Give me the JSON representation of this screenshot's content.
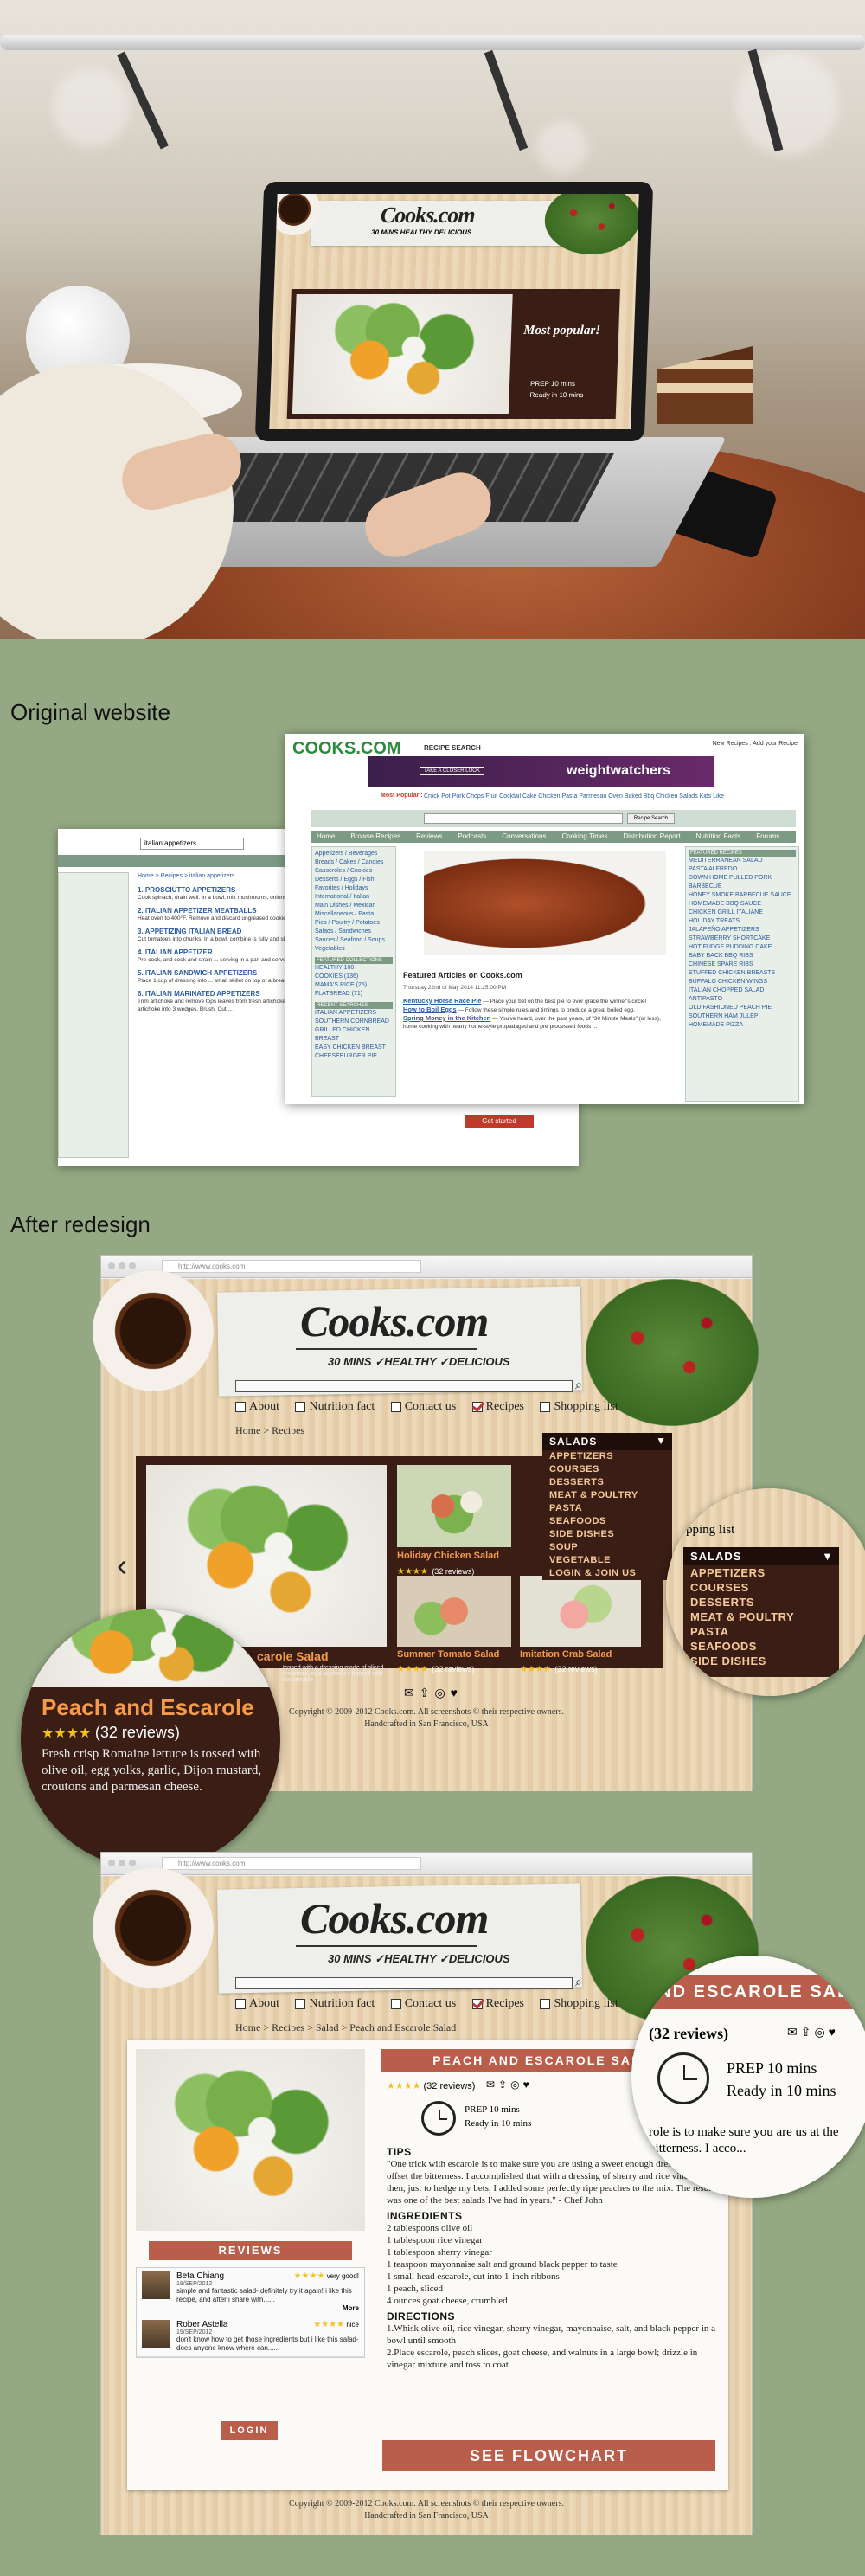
{
  "labels": {
    "original": "Original website",
    "after": "After redesign"
  },
  "laptop": {
    "logo": "Cooks.com",
    "tags": "30 MINS  HEALTHY  DELICIOUS",
    "popular": "Most popular!",
    "prep": "PREP 10 mins",
    "ready": "Ready in 10 mins"
  },
  "orig": {
    "logo": "COOKS.COM",
    "logo_sub": "RECIPE SEARCH",
    "top_links": "New Recipes : Add your Recipe",
    "ad_text": "weightwatchers",
    "ad_btn": "TAKE A CLOSER LOOK",
    "popular_label": "Most Popular :",
    "popular_links": "Crock Pot Pork Chops  Fruit Cocktail Cake  Chicken Pasta Parmesan  Oven Baked Bbq Chicken  Salads Kids Like",
    "search_btn": "Recipe Search",
    "nav": [
      "Home",
      "Browse Recipes",
      "Reviews",
      "Podcasts",
      "Conversations",
      "Cooking Times",
      "Distribution Report",
      "Nutrition Facts",
      "Forums"
    ],
    "categories": [
      "Appetizers / Beverages",
      "Breads / Cakes / Candies",
      "Casseroles / Cookies",
      "Desserts / Eggs / Fish",
      "Favorites / Holidays",
      "International / Italian",
      "Main Dishes / Mexican",
      "Miscellaneous / Pasta",
      "Pies / Poultry / Potatoes",
      "Salads / Sandwiches",
      "Sauces / Seafood / Soups",
      "Vegetables"
    ],
    "featured_collections": "FEATURED COLLECTIONS",
    "collections": [
      "HEALTHY 100",
      "COOKIES (136)",
      "MAMA'S RICE (25)",
      "FLATBREAD (71)"
    ],
    "recent_searches": "RECENT SEARCHES",
    "recent": [
      "ITALIAN APPETIZERS",
      "SOUTHERN CORNBREAD",
      "GRILLED CHICKEN BREAST",
      "EASY CHICKEN BREAST",
      "CHEESEBURGER PIE"
    ],
    "featured_articles": "Featured Articles on Cooks.com",
    "date": "Thursday 22nd of May 2014 11:25:00 PM",
    "articles": [
      {
        "title": "Kentucky Horse Race Pie",
        "text": " — Place your bet on the best pie to ever grace the winner's circle!"
      },
      {
        "title": "How to Boil Eggs",
        "text": " — Follow these simple rules and timings to produce a great boiled egg."
      },
      {
        "title": "Spring Money in the Kitchen",
        "text": " — You've heard, over the past years, of \"30 Minute Meals\" (or less), home cooking with hearty home-style propadaged and pre processed foods ..."
      }
    ],
    "featured_recipes": "FEATURED RECIPES",
    "recipes": [
      "MEDITERRANEAN SALAD",
      "PASTA ALFREDO",
      "DOWN HOME PULLED PORK BARBECUE",
      "HONEY SMOKE BARBECUE SAUCE",
      "HOMEMADE BBQ SAUCE",
      "CHICKEN GRILL ITALIANE",
      "HOLIDAY TREATS",
      "JALAPEÑO APPETIZERS",
      "STRAWBERRY SHORTCAKE",
      "HOT FUDGE PUDDING CAKE",
      "BABY BACK BBQ RIBS",
      "CHINESE SPARE RIBS",
      "STUFFED CHICKEN BREASTS",
      "BUFFALO CHICKEN WINGS",
      "ITALIAN CHOPPED SALAD ANTIPASTO",
      "OLD FASHIONED PEACH PIE",
      "SOUTHERN HAM JULEP",
      "HOMEMADE PIZZA"
    ],
    "back_search": "italian appetizers",
    "back_crumb": "Home > Recipes > italian appetizers",
    "back_results": [
      {
        "title": "1. PROSCIUTTO APPETIZERS",
        "text": "Cook spinach, drain well. In a bowl, mix mushrooms, onions, crisp peppers, and mix. Turn ..."
      },
      {
        "title": "2. ITALIAN APPETIZER MEATBALLS",
        "text": "Heat oven to 400°F. Remove and discard ungreased cookie sheet; place ..."
      },
      {
        "title": "3. APPETIZING ITALIAN BREAD",
        "text": "Cut tomatoes into chunks. In a bowl, combine is fully and shaded but a hint in a toasted pecorino ..."
      },
      {
        "title": "4. ITALIAN APPETIZER",
        "text": "Pre-cook, and cook and strain ... serving in a pan and serve ..."
      },
      {
        "title": "5. ITALIAN SANDWICH APPETIZERS",
        "text": "Place 1 cup of dressing into ... small skillet on top of a bread ..."
      },
      {
        "title": "6. ITALIAN MARINATED APPETIZERS",
        "text": "Trim artichoke and remove tops leaves from fresh artichokes. Cut 1 inch off tops, snip off sharp leaf tips. Cut each artichoke into 3 wedges. Brush. Cut ..."
      }
    ],
    "get_started": "Get started"
  },
  "r1": {
    "url": "http://www.cooks.com",
    "logo": "Cooks.com",
    "tags": [
      "30 MINS",
      "HEALTHY",
      "DELICIOUS"
    ],
    "nav": [
      "About",
      "Nutrition fact",
      "Contact us",
      "Recipes",
      "Shopping list"
    ],
    "crumb": "Home > Recipes",
    "menu_head": "SALADS",
    "menu": [
      "APPETIZERS",
      "COURSES",
      "DESSERTS",
      "MEAT & POULTRY",
      "PASTA",
      "SEAFOODS",
      "SIDE DISHES",
      "SOUP",
      "VEGETABLE",
      "LOGIN & JOIN US"
    ],
    "cards": [
      {
        "title": "Holiday Chicken Salad",
        "reviews": "(32 reviews)"
      },
      {
        "title": "Summer Tomato Salad",
        "reviews": "(32 reviews)"
      },
      {
        "title": "Imitation Crab Salad",
        "reviews": "(32 reviews)"
      }
    ],
    "main_caption": "carole Salad",
    "main_desc": "tossed with a dressing made of sliced tomatoes, and anchovies topped with homemade",
    "footer1": "Copyright © 2009-2012 Cooks.com. All screenshots © their respective owners.",
    "footer2": "Handcrafted in San Francisco, USA",
    "zoom": {
      "title": "Peach and Escarole",
      "reviews": "(32 reviews)",
      "desc": "Fresh crisp Romaine lettuce is tossed with olive oil, egg yolks, garlic, Dijon mustard, croutons and parmesan cheese."
    },
    "zoom2": {
      "shop": "hopping list",
      "head": "SALADS",
      "items": [
        "APPETIZERS",
        "COURSES",
        "DESSERTS",
        "MEAT & POULTRY",
        "PASTA",
        "SEAFOODS",
        "SIDE DISHES"
      ]
    }
  },
  "r2": {
    "crumb": "Home > Recipes > Salad > Peach and Escarole Salad",
    "title": "PEACH AND ESCAROLE SALAD",
    "reviews": "(32 reviews)",
    "prep": "PREP 10 mins",
    "ready": "Ready in 10 mins",
    "tips_head": "TIPS",
    "tips": "\"One trick with escarole is to make sure you are using a sweet enough dressing to offset the bitterness. I accomplished that with a dressing of sherry and rice vinegar, and then, just to hedge my bets, I added some perfectly ripe peaches to the mix. The result was one of the best salads I've had in years.\" - Chef John",
    "ingr_head": "INGREDIENTS",
    "ingredients": [
      "2 tablespoons olive oil",
      "1 tablespoon rice vinegar",
      "1 tablespoon sherry vinegar",
      "1 teaspoon mayonnaise salt and ground black pepper to taste",
      "1 small head escarole, cut into 1-inch ribbons",
      "1 peach, sliced",
      "4 ounces goat cheese, crumbled"
    ],
    "dir_head": "DIRECTIONS",
    "directions": [
      "1.Whisk olive oil, rice vinegar, sherry vinegar, mayonnaise, salt, and black pepper in a bowl until smooth",
      "2.Place escarole, peach slices, goat cheese, and walnuts in a large bowl; drizzle in vinegar mixture and toss to coat."
    ],
    "reviews_head": "REVIEWS",
    "review_list": [
      {
        "name": "Beta Chiang",
        "date": "19/SEP/2012",
        "rating": "very good!",
        "text": "simple and fantastic salad- definitely try it again! i like this recipe, and after i share with......",
        "more": "More"
      },
      {
        "name": "Rober Astella",
        "date": "19/SEP/2012",
        "rating": "nice",
        "text": "don't know how to get those ingredients but i like this salad- does anyone know where can......"
      }
    ],
    "login": "LOGIN",
    "flowchart": "SEE FLOWCHART",
    "zoom": {
      "title": "AND ESCAROLE SALAD",
      "reviews": "(32 reviews)",
      "prep": "PREP 10 mins",
      "ready": "Ready in 10 mins",
      "tail": "role is to make sure you are us at the bitterness. I acco..."
    }
  }
}
